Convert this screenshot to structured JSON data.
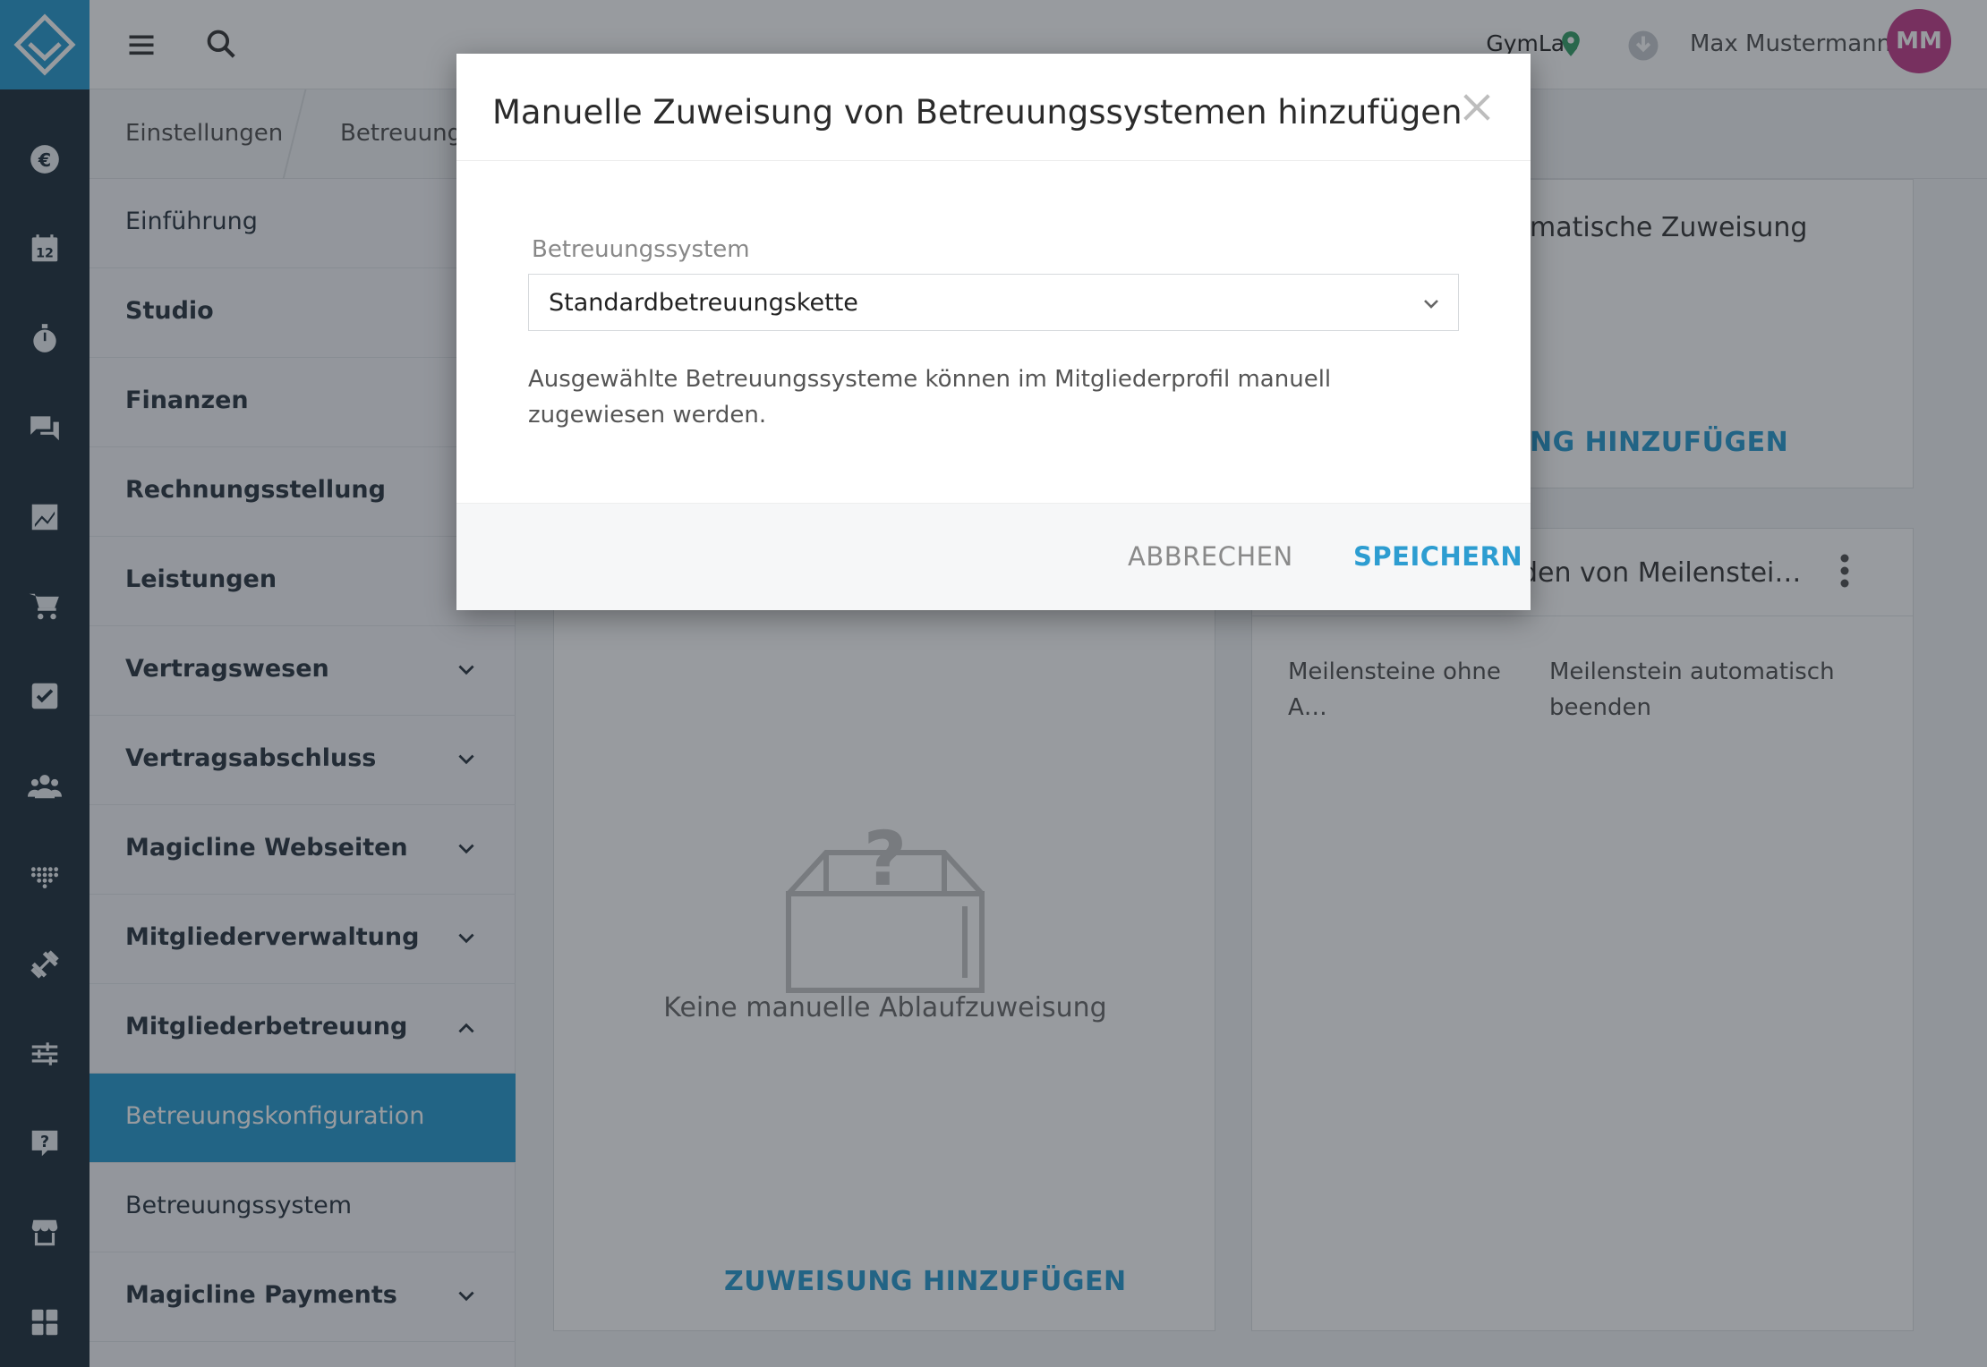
{
  "topbar": {
    "studio_name": "GymLab",
    "user_name": "Max Mustermann",
    "avatar_initials": "MM"
  },
  "breadcrumb": [
    "Einstellungen",
    "Betreuungs"
  ],
  "subnav": {
    "items": [
      {
        "label": "Einführung",
        "bold": false,
        "expandable": false
      },
      {
        "label": "Studio",
        "bold": true,
        "expandable": false
      },
      {
        "label": "Finanzen",
        "bold": true,
        "expandable": false
      },
      {
        "label": "Rechnungsstellung",
        "bold": true,
        "expandable": false
      },
      {
        "label": "Leistungen",
        "bold": true,
        "expandable": false
      },
      {
        "label": "Vertragswesen",
        "bold": true,
        "expandable": true,
        "expanded": false
      },
      {
        "label": "Vertragsabschluss",
        "bold": true,
        "expandable": true,
        "expanded": false
      },
      {
        "label": "Magicline Webseiten",
        "bold": true,
        "expandable": true,
        "expanded": false
      },
      {
        "label": "Mitgliederverwaltung",
        "bold": true,
        "expandable": true,
        "expanded": false
      },
      {
        "label": "Mitgliederbetreuung",
        "bold": true,
        "expandable": true,
        "expanded": true
      },
      {
        "label": "Betreuungskonfiguration",
        "bold": false,
        "expandable": false,
        "active": true
      },
      {
        "label": "Betreuungssystem",
        "bold": false,
        "expandable": false
      },
      {
        "label": "Magicline Payments",
        "bold": true,
        "expandable": true,
        "expanded": false
      }
    ]
  },
  "cards": {
    "auto_assign": {
      "title_visible": "matische Zuweisung",
      "add_link_visible": "NG HINZUFÜGEN"
    },
    "manual_assign": {
      "empty_text": "Keine manuelle Ablaufzuweisung",
      "add_link": "ZUWEISUNG HINZUFÜGEN"
    },
    "milestones": {
      "title_visible": "den von Meilenstei…",
      "col1": "Meilensteine ohne A…",
      "col2": "Meilenstein automatisch beenden"
    }
  },
  "modal": {
    "title": "Manuelle Zuweisung von Betreuungssystemen hinzufügen",
    "field_label": "Betreuungssystem",
    "select_value": "Standardbetreuungskette",
    "help_text": "Ausgewählte Betreuungssysteme können im Mitgliederprofil manuell zugewiesen werden.",
    "cancel_label": "ABBRECHEN",
    "save_label": "SPEICHERN"
  },
  "colors": {
    "accent": "#2d9dd1",
    "rail": "#243440",
    "avatar": "#c5408e",
    "location_pin": "#3aa36b"
  },
  "icons": {
    "rail": [
      "euro-icon",
      "calendar-icon",
      "stopwatch-icon",
      "chat-icon",
      "chart-icon",
      "cart-icon",
      "checkbox-icon",
      "group-icon",
      "dots-grid-icon",
      "dumbbell-icon",
      "sliders-icon",
      "help-chat-icon",
      "store-icon",
      "dashboard-icon"
    ]
  }
}
